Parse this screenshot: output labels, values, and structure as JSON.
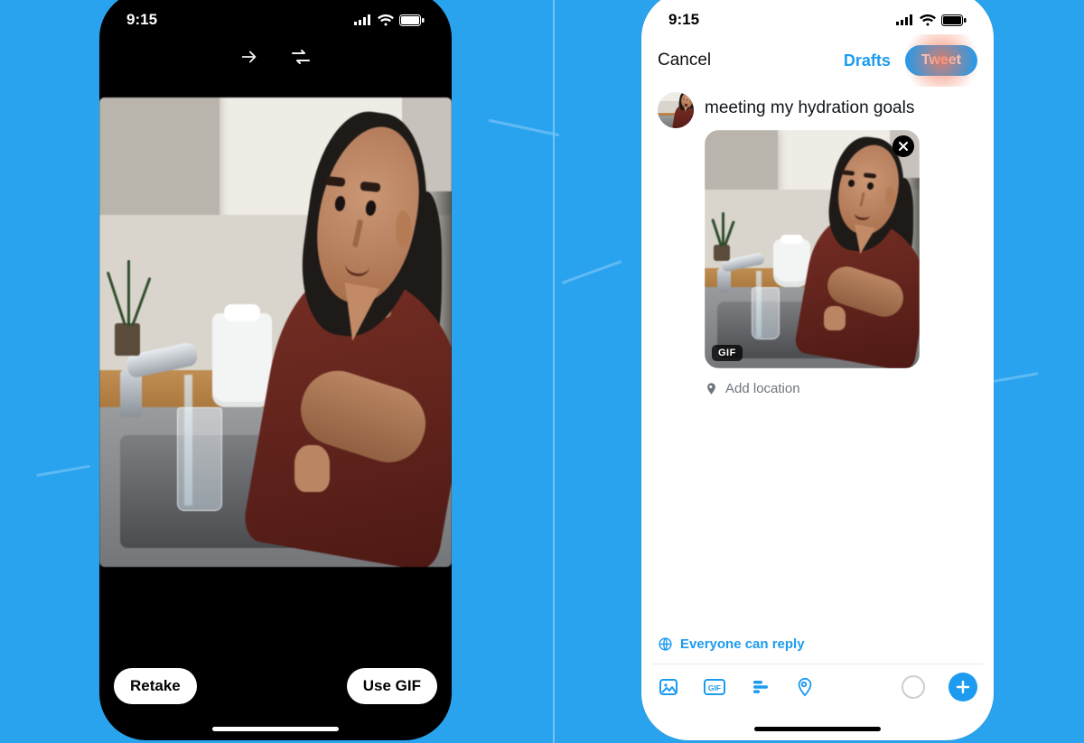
{
  "status": {
    "time": "9:15"
  },
  "phone1": {
    "retake": "Retake",
    "use_gif": "Use GIF"
  },
  "phone2": {
    "cancel": "Cancel",
    "drafts": "Drafts",
    "tweet": "Tweet",
    "compose_text": "meeting my hydration goals",
    "gif_badge": "GIF",
    "add_location": "Add location",
    "reply_scope": "Everyone can reply"
  },
  "colors": {
    "accent": "#1d9bf0"
  }
}
